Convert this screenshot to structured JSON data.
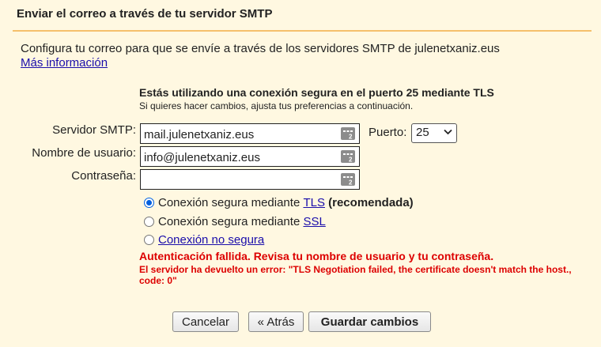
{
  "dialog": {
    "title": "Enviar el correo a través de tu servidor SMTP",
    "intro_text": "Configura tu correo para que se envíe a través de los servidores SMTP de julenetxaniz.eus",
    "more_info_link": "Más información",
    "secure_notice_title": "Estás utilizando una conexión segura en el puerto 25 mediante TLS",
    "secure_notice_sub": "Si quieres hacer cambios, ajusta tus preferencias a continuación."
  },
  "form": {
    "smtp_server_label": "Servidor SMTP:",
    "smtp_server_value": "mail.julenetxaniz.eus",
    "port_label": "Puerto:",
    "port_value": "25",
    "username_label": "Nombre de usuario:",
    "username_value": "info@julenetxaniz.eus",
    "password_label": "Contraseña:",
    "password_value": ""
  },
  "connection_options": [
    {
      "prefix": "Conexión segura mediante ",
      "link": "TLS",
      "suffix": " (recomendada)",
      "checked": true
    },
    {
      "prefix": "Conexión segura mediante ",
      "link": "SSL",
      "suffix": "",
      "checked": false
    },
    {
      "prefix": "",
      "link": "Conexión no segura",
      "suffix": "",
      "checked": false
    }
  ],
  "error": {
    "main": "Autenticación fallida. Revisa tu nombre de usuario y tu contraseña.",
    "detail": "El servidor ha devuelto un error: \"TLS Negotiation failed, the certificate doesn't match the host., code: 0\""
  },
  "buttons": {
    "cancel": "Cancelar",
    "back": "« Atrás",
    "save": "Guardar cambios"
  },
  "colors": {
    "background": "#fff8e1",
    "divider": "#f5c06b",
    "error": "#dd0000",
    "link": "#1a0dab"
  },
  "icons": {
    "field_icon": "password-manager-key-icon",
    "port_dropdown": "chevron-down-icon"
  }
}
